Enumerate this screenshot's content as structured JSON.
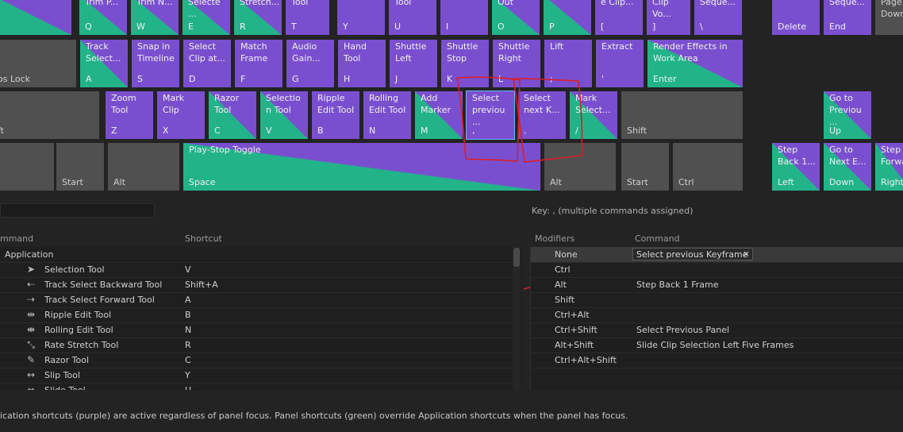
{
  "keyboard": {
    "row0": [
      {
        "id": "qL",
        "cmd": "",
        "letter": "",
        "color": "mix"
      },
      {
        "id": "q",
        "cmd": "Trim P...",
        "letter": "Q",
        "color": "mix"
      },
      {
        "id": "w",
        "cmd": "Trim N...",
        "letter": "W",
        "color": "mix"
      },
      {
        "id": "e",
        "cmd": "Selecte\n...",
        "letter": "E",
        "color": "mix"
      },
      {
        "id": "r",
        "cmd": "Stretch...",
        "letter": "R",
        "color": "mix"
      },
      {
        "id": "t",
        "cmd": "Tool",
        "letter": "T",
        "color": "purple"
      },
      {
        "id": "y",
        "cmd": "",
        "letter": "Y",
        "color": "purple"
      },
      {
        "id": "u",
        "cmd": "Tool",
        "letter": "U",
        "color": "purple"
      },
      {
        "id": "i",
        "cmd": "",
        "letter": "I",
        "color": "purple"
      },
      {
        "id": "o",
        "cmd": "Out",
        "letter": "O",
        "color": "mix"
      },
      {
        "id": "p",
        "cmd": "",
        "letter": "P",
        "color": "mix"
      },
      {
        "id": "lbr",
        "cmd": "e Clip...",
        "letter": "[",
        "color": "purple"
      },
      {
        "id": "rbr",
        "cmd": "Clip Vo...",
        "letter": "]",
        "color": "purple"
      },
      {
        "id": "bsl",
        "cmd": "Seque...",
        "letter": "\\",
        "color": "purple"
      },
      {
        "id": "del",
        "cmd": "",
        "letter": "Delete",
        "color": "purple"
      },
      {
        "id": "end",
        "cmd": "Seque...",
        "letter": "End",
        "color": "purple"
      },
      {
        "id": "pgdn",
        "cmd": "Page\nDown",
        "letter": "",
        "color": "gray"
      }
    ],
    "row1": [
      {
        "id": "caps",
        "cmd": "",
        "letter": "os Lock",
        "color": "gray"
      },
      {
        "id": "a",
        "cmd": "Track\nSelect...",
        "letter": "A",
        "color": "mix"
      },
      {
        "id": "s",
        "cmd": "Snap in\nTimeline",
        "letter": "S",
        "color": "purple"
      },
      {
        "id": "d",
        "cmd": "Select\nClip at...",
        "letter": "D",
        "color": "purple"
      },
      {
        "id": "f",
        "cmd": "Match\nFrame",
        "letter": "F",
        "color": "purple"
      },
      {
        "id": "g",
        "cmd": "Audio\nGain...",
        "letter": "G",
        "color": "purple"
      },
      {
        "id": "h",
        "cmd": "Hand\nTool",
        "letter": "H",
        "color": "purple"
      },
      {
        "id": "j",
        "cmd": "Shuttle\nLeft",
        "letter": "J",
        "color": "purple"
      },
      {
        "id": "k",
        "cmd": "Shuttle\nStop",
        "letter": "K",
        "color": "purple"
      },
      {
        "id": "l",
        "cmd": "Shuttle\nRight",
        "letter": "L",
        "color": "purple"
      },
      {
        "id": "semi",
        "cmd": "Lift",
        "letter": ";",
        "color": "purple"
      },
      {
        "id": "apos",
        "cmd": "Extract",
        "letter": "'",
        "color": "purple"
      },
      {
        "id": "enter",
        "cmd": "Render Effects in\nWork Area",
        "letter": "Enter",
        "color": "mix"
      }
    ],
    "row2": [
      {
        "id": "lshift",
        "cmd": "",
        "letter": "ft",
        "color": "gray"
      },
      {
        "id": "z",
        "cmd": "Zoom\nTool",
        "letter": "Z",
        "color": "purple"
      },
      {
        "id": "x",
        "cmd": "Mark\nClip",
        "letter": "X",
        "color": "purple"
      },
      {
        "id": "c",
        "cmd": "Razor\nTool",
        "letter": "C",
        "color": "mix"
      },
      {
        "id": "v",
        "cmd": "Selectio\nn Tool",
        "letter": "V",
        "color": "mix"
      },
      {
        "id": "b",
        "cmd": "Ripple\nEdit Tool",
        "letter": "B",
        "color": "purple"
      },
      {
        "id": "n",
        "cmd": "Rolling\nEdit Tool",
        "letter": "N",
        "color": "purple"
      },
      {
        "id": "m",
        "cmd": "Add\nMarker",
        "letter": "M",
        "color": "mix"
      },
      {
        "id": "comma",
        "cmd": "Select\nprevіou\n...",
        "letter": ",",
        "color": "purple"
      },
      {
        "id": "period",
        "cmd": "Select\nnext K...",
        "letter": ".",
        "color": "purple"
      },
      {
        "id": "slash",
        "cmd": "Mark\nSelect...",
        "letter": "/",
        "color": "mix"
      },
      {
        "id": "rshift",
        "cmd": "",
        "letter": "Shift",
        "color": "gray"
      },
      {
        "id": "up",
        "cmd": "Go to\nPreviou\n...",
        "letter": "Up",
        "color": "mix"
      }
    ],
    "row3": [
      {
        "id": "ctrlL",
        "cmd": "",
        "letter": "",
        "color": "gray"
      },
      {
        "id": "start",
        "cmd": "",
        "letter": "Start",
        "color": "gray"
      },
      {
        "id": "alt",
        "cmd": "",
        "letter": "Alt",
        "color": "gray"
      },
      {
        "id": "space",
        "cmd": "Play-Stop Toggle",
        "letter": "Space",
        "color": "mix"
      },
      {
        "id": "altR",
        "cmd": "",
        "letter": "Alt",
        "color": "gray"
      },
      {
        "id": "startR",
        "cmd": "",
        "letter": "Start",
        "color": "gray"
      },
      {
        "id": "ctrlR",
        "cmd": "",
        "letter": "Ctrl",
        "color": "gray"
      },
      {
        "id": "left",
        "cmd": "Step\nBack 1...",
        "letter": "Left",
        "color": "mix"
      },
      {
        "id": "down",
        "cmd": "Go to\nNext E...",
        "letter": "Down",
        "color": "mix"
      },
      {
        "id": "right",
        "cmd": "Step\nForwa...",
        "letter": "Right",
        "color": "mix"
      }
    ]
  },
  "key_line": "Key:  , (multiple commands assigned)",
  "left_headers": {
    "command": "mmand",
    "shortcut": "Shortcut"
  },
  "right_headers": {
    "modifiers": "Modifiers",
    "command": "Command"
  },
  "commands": [
    {
      "name": "Application",
      "shortcut": "",
      "icon": "",
      "group": true
    },
    {
      "name": "Selection Tool",
      "shortcut": "V",
      "icon": "selection-arrow-icon"
    },
    {
      "name": "Track Select Backward Tool",
      "shortcut": "Shift+A",
      "icon": "track-select-backward-icon"
    },
    {
      "name": "Track Select Forward Tool",
      "shortcut": "A",
      "icon": "track-select-forward-icon"
    },
    {
      "name": "Ripple Edit Tool",
      "shortcut": "B",
      "icon": "ripple-edit-icon"
    },
    {
      "name": "Rolling Edit Tool",
      "shortcut": "N",
      "icon": "rolling-edit-icon"
    },
    {
      "name": "Rate Stretch Tool",
      "shortcut": "R",
      "icon": "rate-stretch-icon"
    },
    {
      "name": "Razor Tool",
      "shortcut": "C",
      "icon": "razor-icon"
    },
    {
      "name": "Slip Tool",
      "shortcut": "Y",
      "icon": "slip-icon"
    },
    {
      "name": "Slide Tool",
      "shortcut": "U",
      "icon": "slide-icon"
    }
  ],
  "modifiers": [
    {
      "mod": "None",
      "cmd": "Select previous Keyframe",
      "editing": true
    },
    {
      "mod": "Ctrl",
      "cmd": ""
    },
    {
      "mod": "Alt",
      "cmd": "Step Back 1 Frame"
    },
    {
      "mod": "Shift",
      "cmd": ""
    },
    {
      "mod": "Ctrl+Alt",
      "cmd": ""
    },
    {
      "mod": "Ctrl+Shift",
      "cmd": "Select Previous Panel"
    },
    {
      "mod": "Alt+Shift",
      "cmd": "Slide Clip Selection Left Five Frames"
    },
    {
      "mod": "Ctrl+Alt+Shift",
      "cmd": ""
    }
  ],
  "edit_close_glyph": "×",
  "footer_text": "ication shortcuts (purple) are active regardless of panel focus. Panel shortcuts (green) override Application shortcuts when the panel has focus.",
  "colors": {
    "purple": "#7a4fcf",
    "green": "#22b389",
    "annotation": "#d81e2a"
  }
}
